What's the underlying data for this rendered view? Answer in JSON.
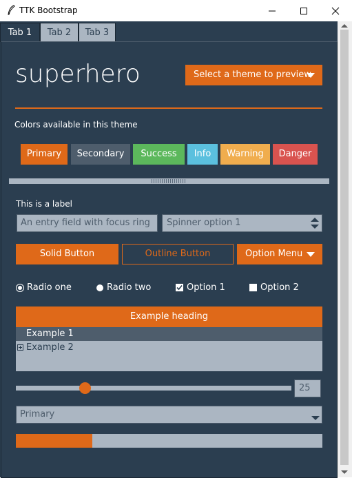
{
  "window": {
    "title": "TTK Bootstrap"
  },
  "tabs": [
    {
      "label": "Tab 1"
    },
    {
      "label": "Tab 2"
    },
    {
      "label": "Tab 3"
    }
  ],
  "header": {
    "theme_name": "superhero",
    "theme_select_label": "Select a theme to preview"
  },
  "colors_section": {
    "label": "Colors available in this theme",
    "buttons": [
      {
        "label": "Primary",
        "color": "#df6919"
      },
      {
        "label": "Secondary",
        "color": "#4e5d6c"
      },
      {
        "label": "Success",
        "color": "#5cb85c"
      },
      {
        "label": "Info",
        "color": "#5bc0de"
      },
      {
        "label": "Warning",
        "color": "#f0ad4e"
      },
      {
        "label": "Danger",
        "color": "#d9534f"
      }
    ]
  },
  "form": {
    "label": "This is a label",
    "entry_value": "An entry field with focus ring",
    "spinner_value": "Spinner option 1",
    "solid_button": "Solid Button",
    "outline_button": "Outline Button",
    "option_menu": "Option Menu",
    "radio_one": "Radio one",
    "radio_two": "Radio two",
    "option_1": "Option 1",
    "option_2": "Option 2",
    "option_1_checked": true,
    "option_2_checked": false
  },
  "treeview": {
    "heading": "Example heading",
    "rows": [
      {
        "label": "Example 1"
      },
      {
        "label": "Example 2"
      }
    ]
  },
  "scale": {
    "value": "25",
    "min": 0,
    "max": 100
  },
  "combobox": {
    "value": "Primary"
  },
  "progress": {
    "value": 0.25
  },
  "colors": {
    "accent": "#df6919",
    "background": "#2b3e50",
    "field": "#abb6c2"
  }
}
